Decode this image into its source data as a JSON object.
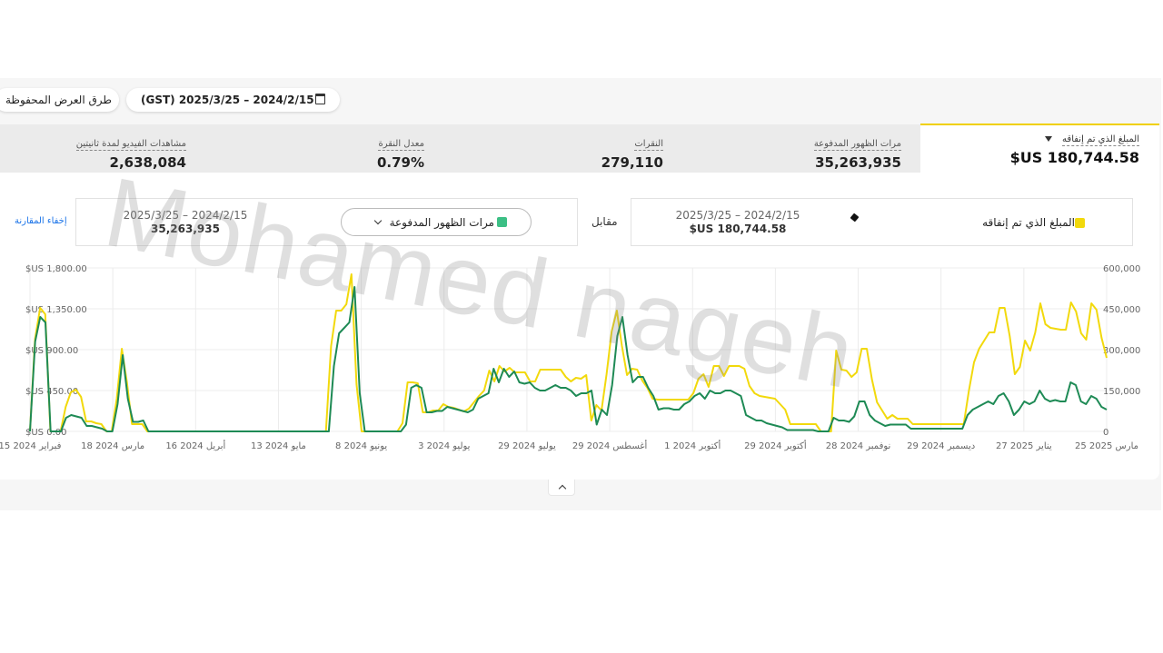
{
  "toolbar": {
    "saved_views": "طرق العرض المحفوظة",
    "date_range": "(GST) 2025/3/25 – 2024/2/15",
    "calendar_icon": "calendar-icon"
  },
  "metrics": [
    {
      "label": "المبلغ الذي تم إنفاقه",
      "value": "$US 180,744.58",
      "active": true
    },
    {
      "label": "مرات الظهور المدفوعة",
      "value": "35,263,935"
    },
    {
      "label": "النقرات",
      "value": "279,110"
    },
    {
      "label": "معدل النقرة",
      "value": "0.79%"
    },
    {
      "label": "مشاهدات الفيديو لمدة ثانيتين",
      "value": "2,638,084"
    }
  ],
  "comparison": {
    "primary": {
      "label": "المبلغ الذي تم إنفاقه",
      "date": "2025/3/25 – 2024/2/15",
      "value": "$US 180,744.58",
      "color": "#f2d90c"
    },
    "versus": "مقابل",
    "secondary": {
      "label": "مرات الظهور المدفوعة",
      "date": "2025/3/25 – 2024/2/15",
      "value": "35,263,935",
      "color": "#3cbf85"
    },
    "hide": "إخفاء المقارنة"
  },
  "watermark": "Mohamed nageh",
  "colors": {
    "spend": "#f2d90c",
    "impressions": "#1e8a55",
    "accent": "#f0d000"
  },
  "chart_data": {
    "type": "line",
    "x_ticks": [
      "15 فبراير 2024",
      "18 مارس 2024",
      "16 أبريل 2024",
      "13 مايو 2024",
      "8 يونيو 2024",
      "3 يوليو 2024",
      "29 يوليو 2024",
      "29 أغسطس 2024",
      "1 أكتوبر 2024",
      "29 أكتوبر 2024",
      "28 نوفمبر 2024",
      "29 ديسمبر 2024",
      "27 يناير 2025",
      "25 مارس 2025"
    ],
    "y_left_ticks": [
      "$US 0.00",
      "$US 450.00",
      "$US 900.00",
      "$US 1,350.00",
      "$US 1,800.00"
    ],
    "y_right_ticks": [
      "0",
      "150,000",
      "300,000",
      "450,000",
      "600,000"
    ],
    "ylim_left": [
      0,
      1800
    ],
    "ylim_right": [
      0,
      600000
    ],
    "grid": true,
    "series": [
      {
        "name": "المبلغ الذي تم إنفاقه",
        "axis": "left",
        "color": "#f2d90c",
        "values": [
          0,
          1020,
          1360,
          1290,
          0,
          0,
          0,
          270,
          430,
          460,
          380,
          110,
          110,
          90,
          80,
          0,
          0,
          360,
          910,
          540,
          80,
          80,
          80,
          0,
          0,
          0,
          0,
          0,
          0,
          0,
          0,
          0,
          0,
          0,
          0,
          0,
          0,
          0,
          0,
          0,
          0,
          0,
          0,
          0,
          0,
          0,
          0,
          0,
          0,
          0,
          0,
          0,
          0,
          0,
          0,
          0,
          0,
          0,
          0,
          940,
          1330,
          1330,
          1400,
          1730,
          520,
          0,
          0,
          0,
          0,
          0,
          0,
          0,
          0,
          90,
          540,
          540,
          530,
          210,
          210,
          230,
          230,
          300,
          270,
          260,
          240,
          220,
          250,
          320,
          390,
          450,
          670,
          550,
          720,
          660,
          700,
          650,
          650,
          650,
          550,
          550,
          680,
          680,
          680,
          680,
          680,
          600,
          550,
          590,
          580,
          620,
          120,
          290,
          230,
          630,
          1100,
          1330,
          940,
          620,
          690,
          680,
          560,
          480,
          360,
          350,
          350,
          350,
          350,
          350,
          350,
          350,
          420,
          580,
          630,
          490,
          720,
          720,
          610,
          720,
          720,
          720,
          690,
          500,
          420,
          390,
          380,
          370,
          360,
          300,
          240,
          80,
          80,
          80,
          80,
          80,
          80,
          0,
          0,
          0,
          890,
          680,
          670,
          600,
          650,
          910,
          910,
          570,
          320,
          230,
          140,
          180,
          140,
          140,
          140,
          80,
          80,
          80,
          80,
          80,
          80,
          80,
          80,
          80,
          80,
          80,
          450,
          760,
          910,
          1000,
          1090,
          1090,
          1360,
          1360,
          1050,
          630,
          710,
          1000,
          890,
          1090,
          1410,
          1180,
          1140,
          1130,
          1120,
          1120,
          1420,
          1320,
          1080,
          1010,
          1410,
          1340,
          1030,
          810
        ]
      },
      {
        "name": "مرات الظهور المدفوعة",
        "axis": "right",
        "color": "#1e8a55",
        "values": [
          0,
          330000,
          420000,
          400000,
          0,
          0,
          0,
          50000,
          60000,
          55000,
          50000,
          20000,
          20000,
          15000,
          10000,
          0,
          0,
          100000,
          280000,
          120000,
          35000,
          35000,
          40000,
          0,
          0,
          0,
          0,
          0,
          0,
          0,
          0,
          0,
          0,
          0,
          0,
          0,
          0,
          0,
          0,
          0,
          0,
          0,
          0,
          0,
          0,
          0,
          0,
          0,
          0,
          0,
          0,
          0,
          0,
          0,
          0,
          0,
          0,
          0,
          0,
          240000,
          360000,
          380000,
          400000,
          530000,
          140000,
          0,
          0,
          0,
          0,
          0,
          0,
          0,
          0,
          25000,
          160000,
          170000,
          160000,
          70000,
          70000,
          75000,
          75000,
          90000,
          85000,
          80000,
          75000,
          70000,
          80000,
          120000,
          130000,
          140000,
          230000,
          180000,
          230000,
          200000,
          220000,
          180000,
          175000,
          180000,
          160000,
          150000,
          150000,
          160000,
          170000,
          160000,
          160000,
          150000,
          130000,
          140000,
          140000,
          150000,
          25000,
          80000,
          60000,
          170000,
          350000,
          420000,
          280000,
          180000,
          200000,
          200000,
          160000,
          130000,
          80000,
          85000,
          85000,
          80000,
          80000,
          100000,
          110000,
          130000,
          140000,
          120000,
          150000,
          140000,
          140000,
          150000,
          150000,
          140000,
          130000,
          60000,
          50000,
          40000,
          40000,
          30000,
          25000,
          20000,
          15000,
          5000,
          5000,
          5000,
          5000,
          5000,
          5000,
          0,
          0,
          0,
          50000,
          40000,
          40000,
          35000,
          55000,
          110000,
          110000,
          60000,
          40000,
          30000,
          20000,
          25000,
          25000,
          25000,
          25000,
          10000,
          10000,
          10000,
          10000,
          10000,
          10000,
          10000,
          10000,
          10000,
          10000,
          10000,
          60000,
          80000,
          90000,
          100000,
          110000,
          100000,
          130000,
          140000,
          110000,
          60000,
          80000,
          110000,
          100000,
          110000,
          150000,
          120000,
          110000,
          115000,
          110000,
          110000,
          180000,
          170000,
          110000,
          100000,
          130000,
          120000,
          90000,
          80000
        ]
      }
    ]
  }
}
